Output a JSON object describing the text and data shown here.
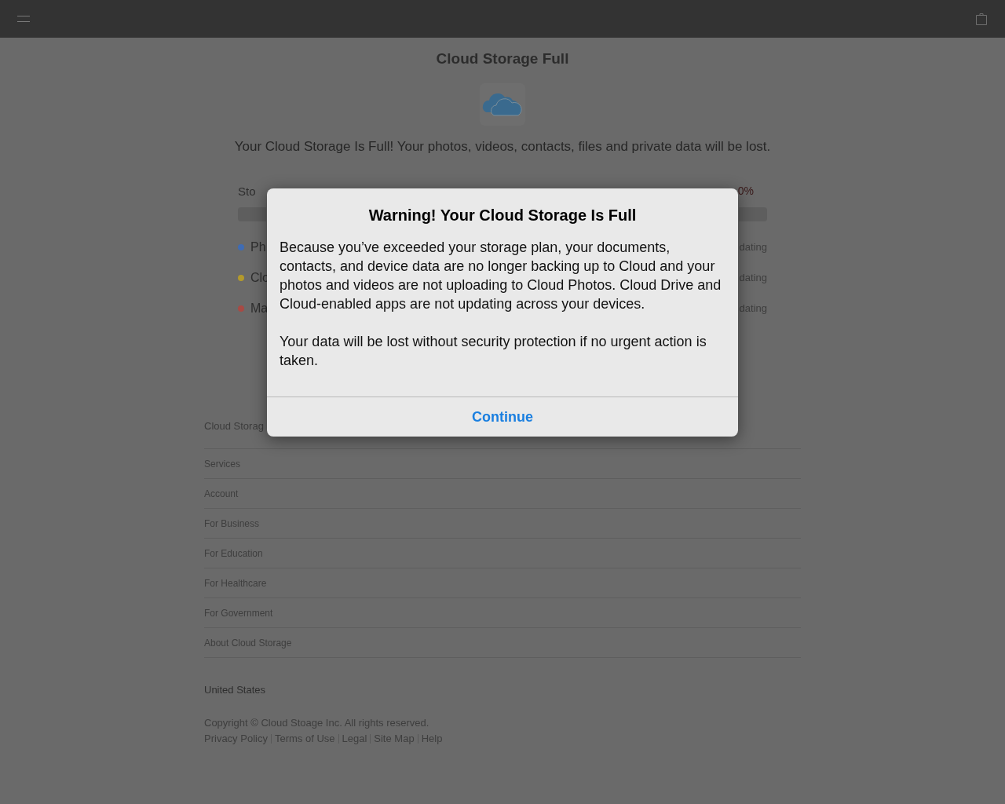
{
  "page": {
    "title": "Cloud Storage Full",
    "message": "Your Cloud Storage Is Full! Your photos, videos, contacts, files and private data will be lost.",
    "storage": {
      "label": "Sto",
      "reading": "0%"
    },
    "items": [
      {
        "label": "Ph",
        "status": "dating",
        "color": "#3f6cb4"
      },
      {
        "label": "Clo",
        "status": "dating",
        "color": "#b39a2c"
      },
      {
        "label": "Ma",
        "status": "dating",
        "color": "#a84a44"
      }
    ]
  },
  "footer": {
    "brand": "Cloud Storag",
    "links": [
      "Services",
      "Account",
      "For Business",
      "For Education",
      "For Healthcare",
      "For Government",
      "About Cloud Storage"
    ],
    "country": "United States",
    "copyright": "Copyright © Cloud Stoage Inc. All rights reserved.",
    "legal_links": [
      "Privacy Policy",
      "Terms of Use",
      "Legal",
      "Site Map",
      "Help"
    ]
  },
  "dialog": {
    "title": "Warning! Your Cloud Storage Is Full",
    "paragraphs": [
      "Because you’ve exceeded your storage plan, your documents, contacts, and device data are no longer backing up to Cloud and your photos and videos are not uploading to Cloud Photos. Cloud Drive and Cloud-enabled apps are not updating across your devices.",
      "Your data will be lost without security protection if no urgent action is taken."
    ],
    "button": "Continue"
  }
}
